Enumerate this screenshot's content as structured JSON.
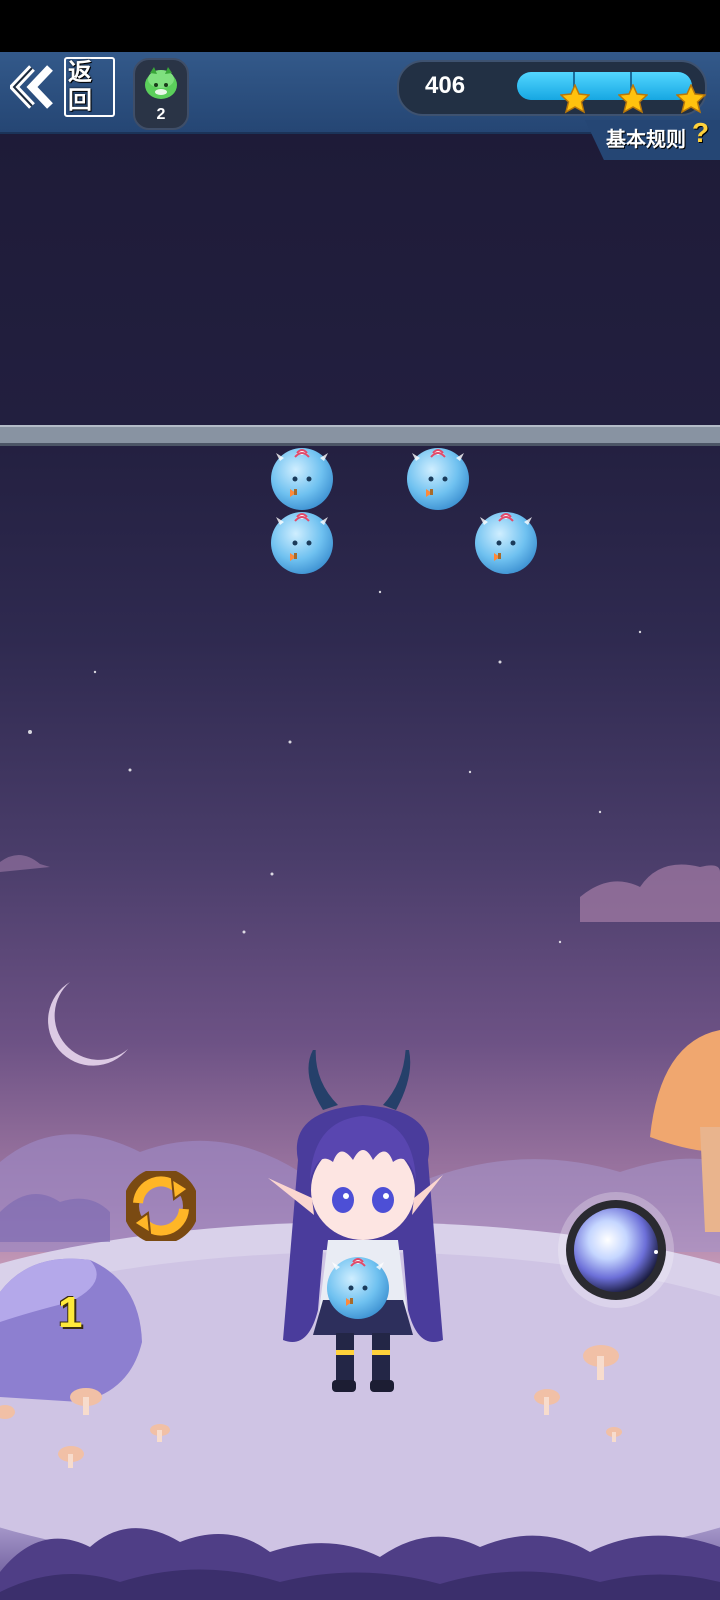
{
  "topbar": {
    "back_label": "返回",
    "lives_count": "2",
    "score": "406",
    "progress_fraction": 1.0,
    "stars_earned": 3,
    "rules_label": "基本规则",
    "rules_help_glyph": "?"
  },
  "board": {
    "bubbles": [
      {
        "row": 0,
        "col": 4,
        "type": "blue-creature"
      },
      {
        "row": 0,
        "col": 6,
        "type": "blue-creature"
      },
      {
        "row": 1,
        "col": 4,
        "type": "blue-creature"
      },
      {
        "row": 1,
        "col": 7,
        "type": "blue-creature"
      }
    ]
  },
  "player": {
    "remaining_shots": "1",
    "current_bubble": "blue-creature"
  },
  "icons": {
    "back": "double-chevron-left-icon",
    "lives": "green-creature-icon",
    "star": "star-icon",
    "swap": "swap-arrows-icon",
    "power": "power-orb-icon"
  },
  "colors": {
    "topbar": "#254674",
    "progress": "#16a7e2",
    "star": "#ffc20e",
    "level_number": "#ffe93b",
    "rules_q": "#ffd13b"
  }
}
